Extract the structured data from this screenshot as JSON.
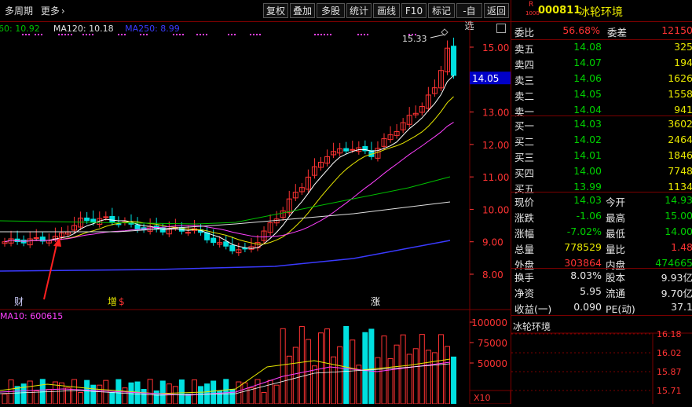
{
  "toolbar": {
    "period": "多周期",
    "more": "更多",
    "more_arrow": "›",
    "buttons": [
      "复权",
      "叠加",
      "多股",
      "统计",
      "画线",
      "F10",
      "标记",
      "-自选",
      "返回"
    ]
  },
  "ma_legend": [
    {
      "text": "60: 10.92",
      "color": "#00c000"
    },
    {
      "text": "MA120: 10.18",
      "color": "#e0e0e0"
    },
    {
      "text": "MA250: 8.99",
      "color": "#3a3aff"
    }
  ],
  "volume_legend": "MA10: 600615",
  "price_axis": {
    "ticks": [
      "15.00",
      "14.00",
      "13.00",
      "12.00",
      "11.00",
      "10.00",
      "9.00",
      "8.00"
    ],
    "current": "14.05",
    "high_label": "15.33"
  },
  "volume_axis": {
    "ticks": [
      "100000",
      "75000",
      "50000"
    ],
    "unit": "X10"
  },
  "event_markers": [
    {
      "text": "财"
    },
    {
      "text": "增"
    },
    {
      "text": "$"
    },
    {
      "text": "涨"
    }
  ],
  "quote": {
    "r_badge": "R",
    "market_code": "1000",
    "code": "000811",
    "name": "冰轮环境",
    "weibi_label": "委比",
    "weibi": "56.68%",
    "weicha_label": "委差",
    "weicha": "12150",
    "asks": [
      {
        "label": "卖五",
        "price": "14.08",
        "vol": "325"
      },
      {
        "label": "卖四",
        "price": "14.07",
        "vol": "194"
      },
      {
        "label": "卖三",
        "price": "14.06",
        "vol": "1626"
      },
      {
        "label": "卖二",
        "price": "14.05",
        "vol": "1558"
      },
      {
        "label": "卖一",
        "price": "14.04",
        "vol": "941"
      }
    ],
    "bids": [
      {
        "label": "买一",
        "price": "14.03",
        "vol": "3602"
      },
      {
        "label": "买二",
        "price": "14.02",
        "vol": "2464"
      },
      {
        "label": "买三",
        "price": "14.01",
        "vol": "1846"
      },
      {
        "label": "买四",
        "price": "14.00",
        "vol": "7748"
      },
      {
        "label": "买五",
        "price": "13.99",
        "vol": "1134"
      }
    ],
    "stats": [
      {
        "l1": "现价",
        "v1": "14.03",
        "c1": "green",
        "l2": "今开",
        "v2": "14.93",
        "c2": "green"
      },
      {
        "l1": "涨跌",
        "v1": "-1.06",
        "c1": "green",
        "l2": "最高",
        "v2": "15.00",
        "c2": "green"
      },
      {
        "l1": "涨幅",
        "v1": "-7.02%",
        "c1": "green",
        "l2": "最低",
        "v2": "14.00",
        "c2": "green"
      },
      {
        "l1": "总量",
        "v1": "778529",
        "c1": "yellow",
        "l2": "量比",
        "v2": "1.48",
        "c2": "red"
      },
      {
        "l1": "外盘",
        "v1": "303864",
        "c1": "red",
        "l2": "内盘",
        "v2": "474665",
        "c2": "green"
      }
    ],
    "extra": [
      {
        "l1": "换手",
        "v1": "8.03%",
        "l2": "股本",
        "v2": "9.93亿"
      },
      {
        "l1": "净资",
        "v1": "5.95",
        "l2": "流通",
        "v2": "9.70亿"
      },
      {
        "l1": "收益(一)",
        "v1": "0.090",
        "l2": "PE(动)",
        "v2": "37.1"
      }
    ],
    "mini_title": "冰轮环境",
    "mini_ticks": [
      "16.18",
      "16.02",
      "15.87",
      "15.71"
    ]
  },
  "colors": {
    "up": "#ff3333",
    "down": "#00e0e0",
    "ma5": "#ffffff",
    "ma10": "#e8e800",
    "ma20": "#ff40ff",
    "ma60": "#00c000",
    "ma120": "#e0e0e0",
    "ma250": "#3a3aff",
    "frame": "#7a0000"
  }
}
